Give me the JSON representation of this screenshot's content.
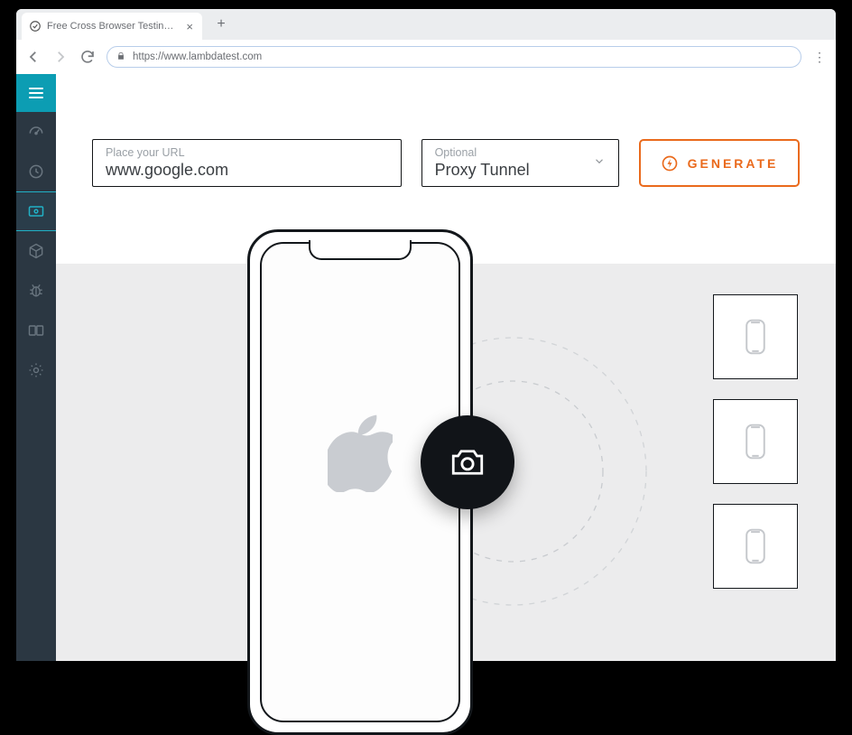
{
  "browser": {
    "tab_title": "Free Cross Browser Testing Clou",
    "url": "https://www.lambdatest.com"
  },
  "sidebar": {
    "items": [
      {
        "name": "dashboard-icon"
      },
      {
        "name": "history-icon"
      },
      {
        "name": "visual-ui-icon"
      },
      {
        "name": "package-icon"
      },
      {
        "name": "bug-icon"
      },
      {
        "name": "compare-icon"
      },
      {
        "name": "settings-icon"
      }
    ],
    "active_index": 2
  },
  "controls": {
    "url_label": "Place your URL",
    "url_value": "www.google.com",
    "tunnel_label": "Optional",
    "tunnel_value": "Proxy Tunnel",
    "generate_label": "GENERATE"
  },
  "phone": {
    "os_icon": "apple-icon"
  },
  "thumbs": {
    "count": 3,
    "icon": "device-icon"
  },
  "camera": {
    "icon": "camera-icon"
  },
  "colors": {
    "accent_teal": "#0c9db3",
    "accent_orange": "#ea6a1c",
    "sidebar_bg": "#2b3742"
  }
}
